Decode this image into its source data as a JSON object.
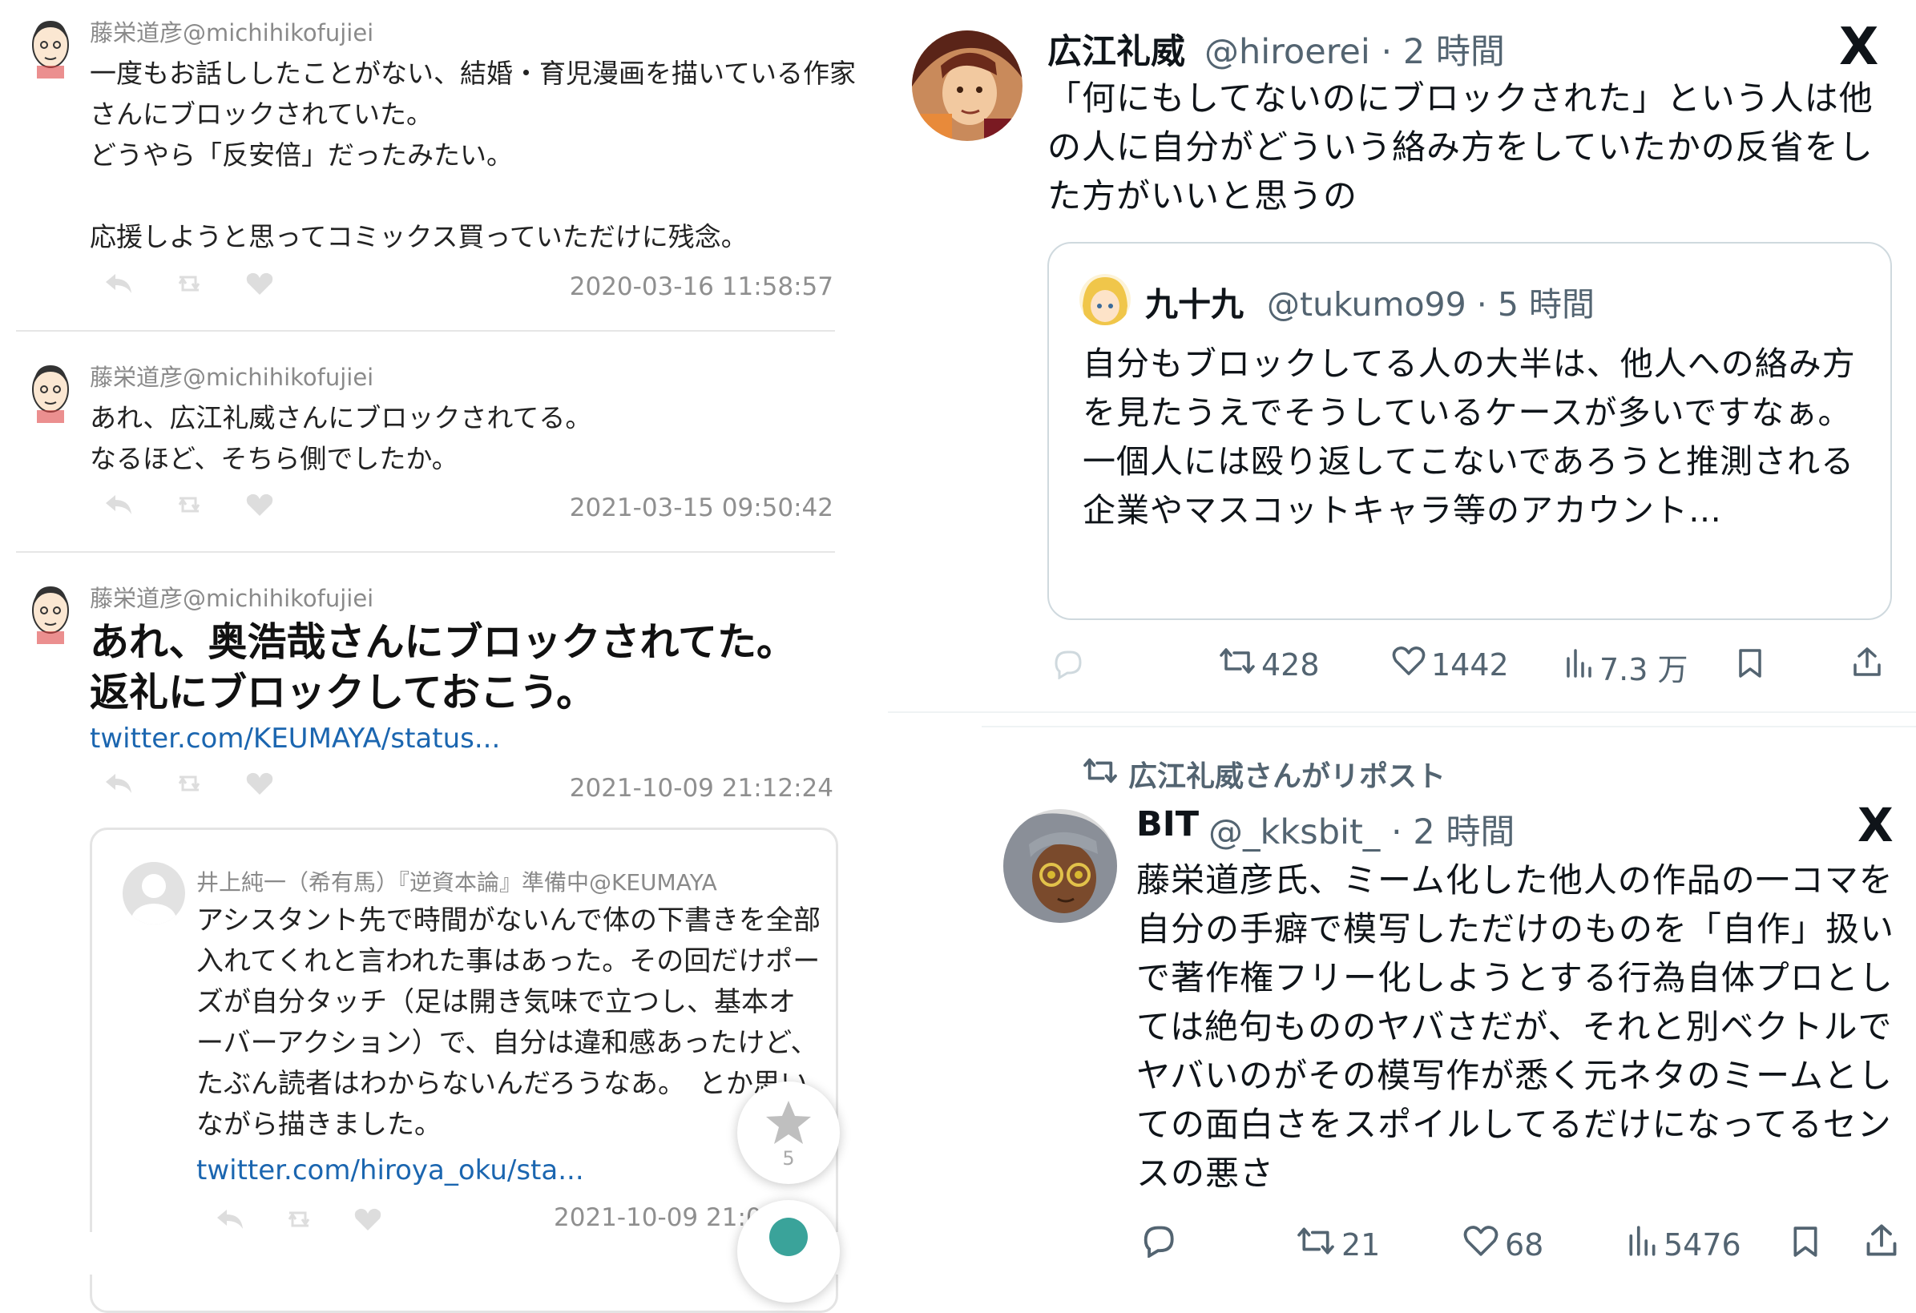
{
  "left": {
    "tweets": [
      {
        "handle": "藤栄道彦@michihikofujiei",
        "body": "一度もお話ししたことがない、結婚・育児漫画を描いている作家さんにブロックされていた。\nどうやら「反安倍」だったみたい。\n\n応援しようと思ってコミックス買っていただけに残念。",
        "date": "2020-03-16 11:58:57"
      },
      {
        "handle": "藤栄道彦@michihikofujiei",
        "body": "あれ、広江礼威さんにブロックされてる。\nなるほど、そちら側でしたか。",
        "date": "2021-03-15 09:50:42"
      },
      {
        "handle": "藤栄道彦@michihikofujiei",
        "body": "あれ、奥浩哉さんにブロックされてた。\n返礼にブロックしておこう。",
        "link": "twitter.com/KEUMAYA/status...",
        "date": "2021-10-09 21:12:24"
      }
    ],
    "embedded": {
      "handle": "井上純一（希有馬）『逆資本論』準備中@KEUMAYA",
      "body": "アシスタント先で時間がないんで体の下書きを全部入れてくれと言われた事はあった。その回だけポーズが自分タッチ（足は開き気味で立つし、基本オーバーアクション）で、自分は違和感あったけど、たぶん読者はわからないんだろうなあ。　とか思いながら描きました。",
      "link": "twitter.com/hiroya_oku/sta...",
      "date": "2021-10-09 21:0"
    },
    "fab_count": "5"
  },
  "right": {
    "tweet1": {
      "name": "広江礼威",
      "handle": "@hiroerei · 2 時間",
      "body": "「何にもしてないのにブロックされた」という人は他の人に自分がどういう絡み方をしていたかの反省をした方がいいと思うの",
      "quote": {
        "name": "九十九",
        "handle": "@tukumo99 · 5 時間",
        "body": "自分もブロックしてる人の大半は、他人への絡み方を見たうえでそうしているケースが多いですなぁ。\n一個人には殴り返してこないであろうと推測される企業やマスコットキャラ等のアカウント…"
      },
      "reposts": "428",
      "likes": "1442",
      "views": "7.3 万"
    },
    "repost_note": "広江礼威さんがリポスト",
    "tweet2": {
      "name": "BIT",
      "handle": "@_kksbit_ · 2 時間",
      "body": "藤栄道彦氏、ミーム化した他人の作品の一コマを自分の手癖で模写しただけのものを「自作」扱いで著作権フリー化しようとする行為自体プロとしては絶句もののヤバさだが、それと別ベクトルでヤバいのがその模写作が悉く元ネタのミームとしての面白さをスポイルしてるだけになってるセンスの悪さ",
      "reposts": "21",
      "likes": "68",
      "views": "5476"
    },
    "x_logo": "X"
  },
  "colors": {
    "link_blue": "#1b66b0",
    "x_gray": "#536471",
    "border": "#cfd9de"
  }
}
